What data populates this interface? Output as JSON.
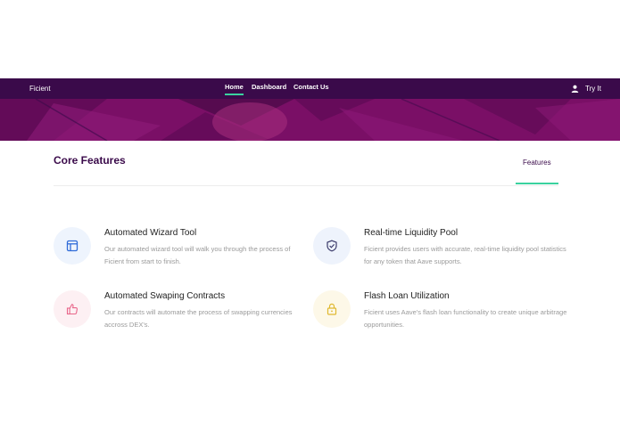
{
  "nav": {
    "brand": "Ficient",
    "links": [
      {
        "label": "Home",
        "active": true
      },
      {
        "label": "Dashboard",
        "active": false
      },
      {
        "label": "Contact Us",
        "active": false
      }
    ],
    "try_label": "Try It",
    "user_icon": "user-icon"
  },
  "section": {
    "title": "Core Features",
    "tab_label": "Features"
  },
  "features": [
    {
      "title": "Automated Wizard Tool",
      "description": "Our automated wizard tool will walk you through the process of Ficient from start to finish.",
      "icon": "browser-window-icon",
      "icon_color": "#2f6bd8",
      "circle_color": "#eef4fd"
    },
    {
      "title": "Real-time Liquidity Pool",
      "description": "Ficient provides users with accurate, real-time liquidity pool statistics for any token that Aave supports.",
      "icon": "shield-check-icon",
      "icon_color": "#3a3a6a",
      "circle_color": "#eef3fc"
    },
    {
      "title": "Automated Swaping Contracts",
      "description": "Our contracts will automate the process of swapping currencies accross DEX's.",
      "icon": "thumbs-up-icon",
      "icon_color": "#e8668a",
      "circle_color": "#fdf0f3"
    },
    {
      "title": "Flash Loan Utilization",
      "description": "Ficient uses Aave's flash loan functionality to create unique arbitrage opportunities.",
      "icon": "padlock-icon",
      "icon_color": "#e0b830",
      "circle_color": "#fdf8e8"
    }
  ],
  "colors": {
    "navbar": "#3a0a4a",
    "hero": "#7a0f66",
    "accent": "#3ad29f",
    "title": "#3a0a4a"
  }
}
